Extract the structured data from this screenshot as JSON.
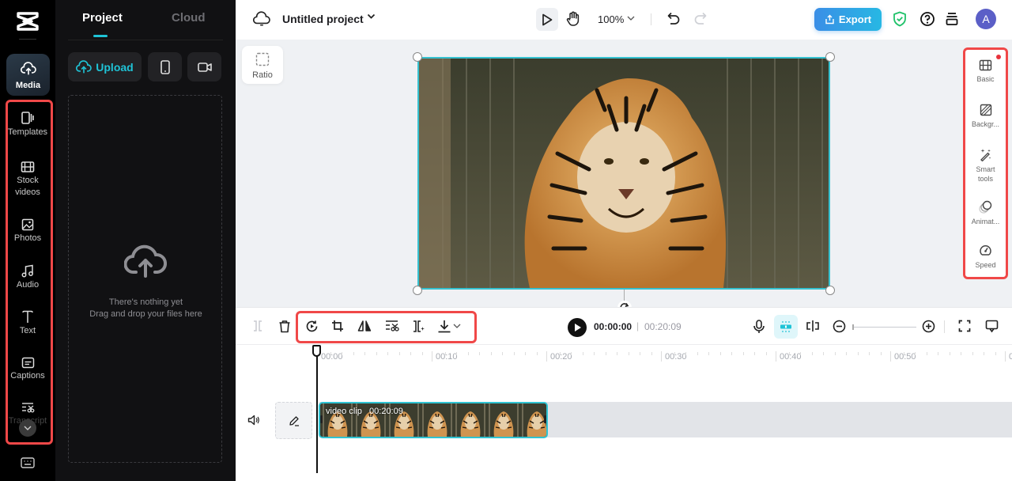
{
  "rail": {
    "media": "Media",
    "items": [
      {
        "label": "Templates",
        "icon": "templates-icon"
      },
      {
        "label": "Stock\nvideos",
        "icon": "film-icon"
      },
      {
        "label": "Photos",
        "icon": "image-icon"
      },
      {
        "label": "Audio",
        "icon": "music-icon"
      },
      {
        "label": "Text",
        "icon": "text-icon"
      },
      {
        "label": "Captions",
        "icon": "captions-icon"
      },
      {
        "label": "Transcript",
        "icon": "transcript-icon"
      }
    ]
  },
  "panel": {
    "tabs": [
      "Project",
      "Cloud"
    ],
    "active_tab": "Project",
    "upload_label": "Upload",
    "empty_title": "There's nothing yet",
    "empty_hint": "Drag and drop your files here"
  },
  "topbar": {
    "project_title": "Untitled project",
    "zoom": "100%",
    "export_label": "Export",
    "avatar_initial": "A"
  },
  "stage": {
    "ratio_label": "Ratio"
  },
  "properties": {
    "items": [
      {
        "label": "Basic",
        "icon": "basic-icon",
        "badge": true
      },
      {
        "label": "Backgr...",
        "icon": "background-icon"
      },
      {
        "label": "Smart\ntools",
        "icon": "magic-wand-icon"
      },
      {
        "label": "Animat...",
        "icon": "animation-icon"
      },
      {
        "label": "Speed",
        "icon": "speed-icon"
      }
    ]
  },
  "playback": {
    "current_time": "00:00:00",
    "separator": "|",
    "duration": "00:20:09"
  },
  "timeline": {
    "ruler_labels": [
      "00:00",
      "00:10",
      "00:20",
      "00:30",
      "00:40",
      "00:50",
      "0"
    ],
    "clip_name": "video clip",
    "clip_duration": "00:20:09"
  },
  "colors": {
    "accent": "#1fc3d6",
    "export_start": "#3a8ee6",
    "export_end": "#27b8e4",
    "highlight_box": "#f04848",
    "avatar": "#5b5fc7",
    "shield": "#20c26a"
  }
}
